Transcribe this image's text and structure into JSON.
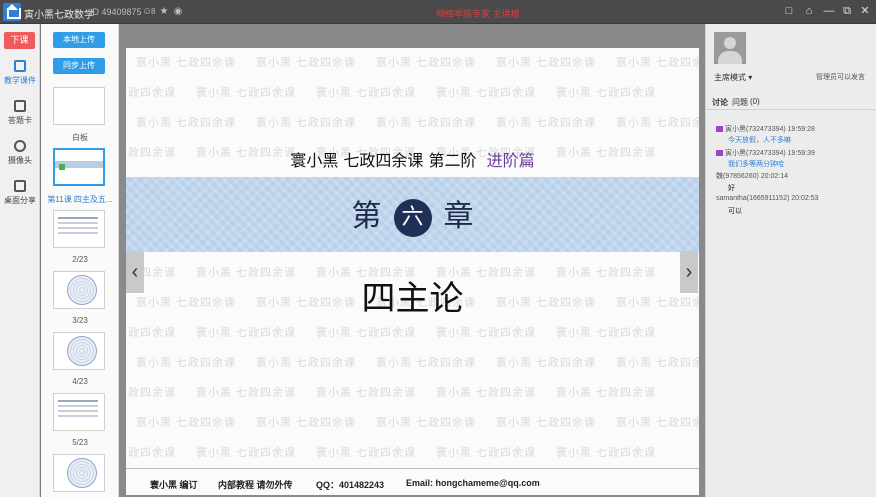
{
  "titlebar": {
    "app_title": "寅小黑七政数学",
    "room_id": "ID 49409875",
    "online_count": "8",
    "notice": "网络举报专家 主讲授"
  },
  "leftnav": {
    "leave_label": "下课",
    "items": [
      {
        "label": "教学课件",
        "icon": "courseware-icon",
        "active": true
      },
      {
        "label": "答题卡",
        "icon": "answer-card-icon"
      },
      {
        "label": "摄像头",
        "icon": "camera-icon"
      },
      {
        "label": "桌面分享",
        "icon": "desktop-share-icon"
      }
    ]
  },
  "thumbs": {
    "upload_local": "本地上传",
    "upload_sync": "同步上传",
    "items": [
      {
        "label": "白板"
      },
      {
        "label": "第11课 四主及五..."
      },
      {
        "label": "2/23"
      },
      {
        "label": "3/23"
      },
      {
        "label": "4/23"
      },
      {
        "label": "5/23"
      }
    ]
  },
  "slide": {
    "watermark": "寰小黑 七政四余课",
    "header_main": "寰小黑  七政四余课  第二阶",
    "header_accent": "进阶篇",
    "chapter_left": "第",
    "chapter_num": "六",
    "chapter_right": "章",
    "title": "四主论",
    "footer": {
      "editor": "寰小黑 编订",
      "internal": "内部教程  请勿外传",
      "qq": "QQ：401482243",
      "email": "Email: hongchameme@qq.com"
    }
  },
  "rightpanel": {
    "mode": "主席模式 ▾",
    "mode_note": "管理员可以发言",
    "tab_discuss": "讨论",
    "tab_question": "问题",
    "question_count": "(0)",
    "messages": [
      {
        "who": "寅小黑(732473394) 19:59:28",
        "text": "今天放假，人不多嘛",
        "highlight": true
      },
      {
        "who": "寅小黑(732473394) 19:59:39",
        "text": "我们多等两分钟哈",
        "highlight": true
      },
      {
        "who": "魏(97856260) 20:02:14",
        "text": "好",
        "highlight": false
      },
      {
        "who": "samantha(1665911152) 20:02:53",
        "text": "可以",
        "highlight": false
      }
    ]
  },
  "colors": {
    "accent": "#2f7fd6",
    "leave": "#f05a5a",
    "slide_band": "#b9d0ea",
    "chapter_circle": "#1f2f55",
    "header_accent": "#6a3d9a"
  }
}
